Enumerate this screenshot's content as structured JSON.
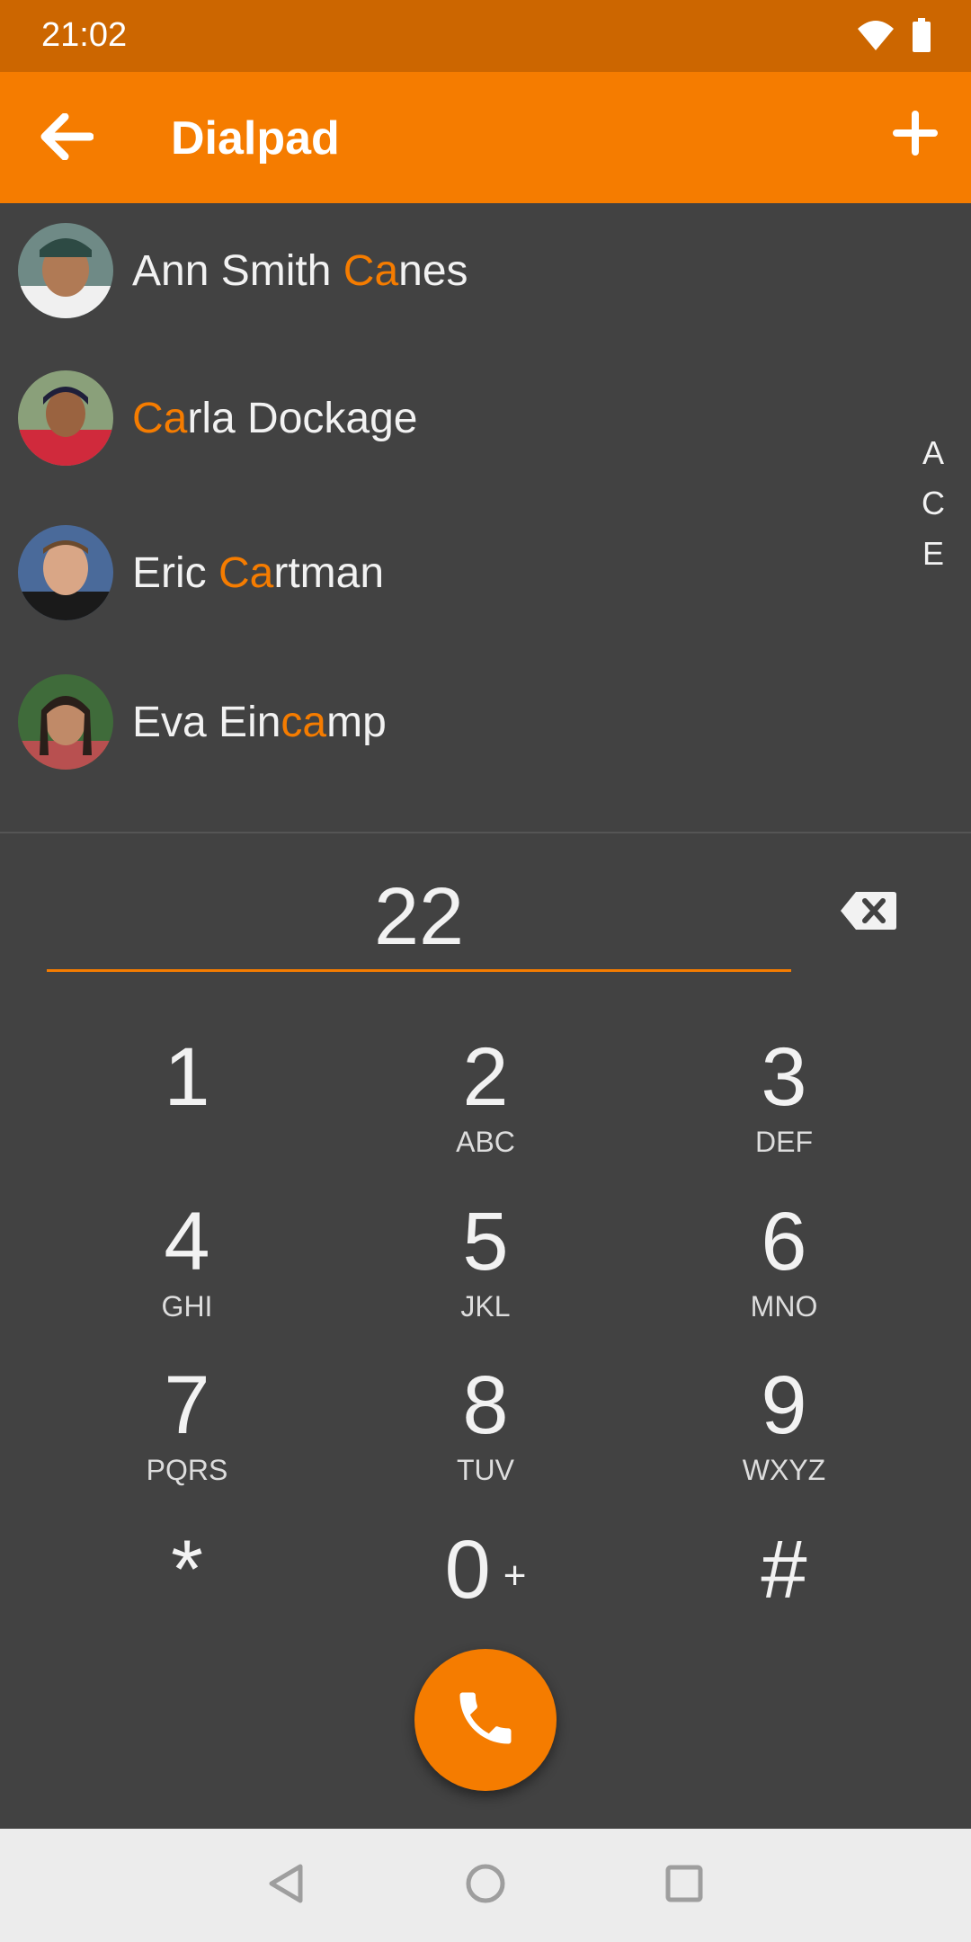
{
  "status_bar": {
    "time": "21:02",
    "icons": [
      "wifi-icon",
      "battery-icon"
    ]
  },
  "app_bar": {
    "title": "Dialpad",
    "back_icon": "arrow-left-icon",
    "add_icon": "plus-icon"
  },
  "contacts": [
    {
      "name_before": "Ann Smith ",
      "name_match": "Ca",
      "name_after": "nes",
      "avatar": "avatar-photo"
    },
    {
      "name_before": "",
      "name_match": "Ca",
      "name_after": "rla Dockage",
      "avatar": "avatar-photo"
    },
    {
      "name_before": "Eric ",
      "name_match": "Ca",
      "name_after": "rtman",
      "avatar": "avatar-photo"
    },
    {
      "name_before": "Eva Ein",
      "name_match": "ca",
      "name_after": "mp",
      "avatar": "avatar-photo"
    }
  ],
  "index_letters": [
    "A",
    "C",
    "E"
  ],
  "dial_input": {
    "value": "22",
    "backspace_icon": "backspace-icon"
  },
  "keypad": [
    {
      "digit": "1",
      "letters": ""
    },
    {
      "digit": "2",
      "letters": "ABC"
    },
    {
      "digit": "3",
      "letters": "DEF"
    },
    {
      "digit": "4",
      "letters": "GHI"
    },
    {
      "digit": "5",
      "letters": "JKL"
    },
    {
      "digit": "6",
      "letters": "MNO"
    },
    {
      "digit": "7",
      "letters": "PQRS"
    },
    {
      "digit": "8",
      "letters": "TUV"
    },
    {
      "digit": "9",
      "letters": "WXYZ"
    },
    {
      "digit": "*",
      "letters": ""
    },
    {
      "digit": "0",
      "letters": "",
      "extra": "+"
    },
    {
      "digit": "#",
      "letters": ""
    }
  ],
  "call_button": {
    "icon": "phone-icon"
  },
  "colors": {
    "accent": "#f57c00",
    "status_bar": "#cc6600",
    "background": "#424242",
    "nav_bar": "#ececec"
  },
  "nav_bar": {
    "buttons": [
      "back-triangle-icon",
      "home-circle-icon",
      "recents-square-icon"
    ]
  }
}
